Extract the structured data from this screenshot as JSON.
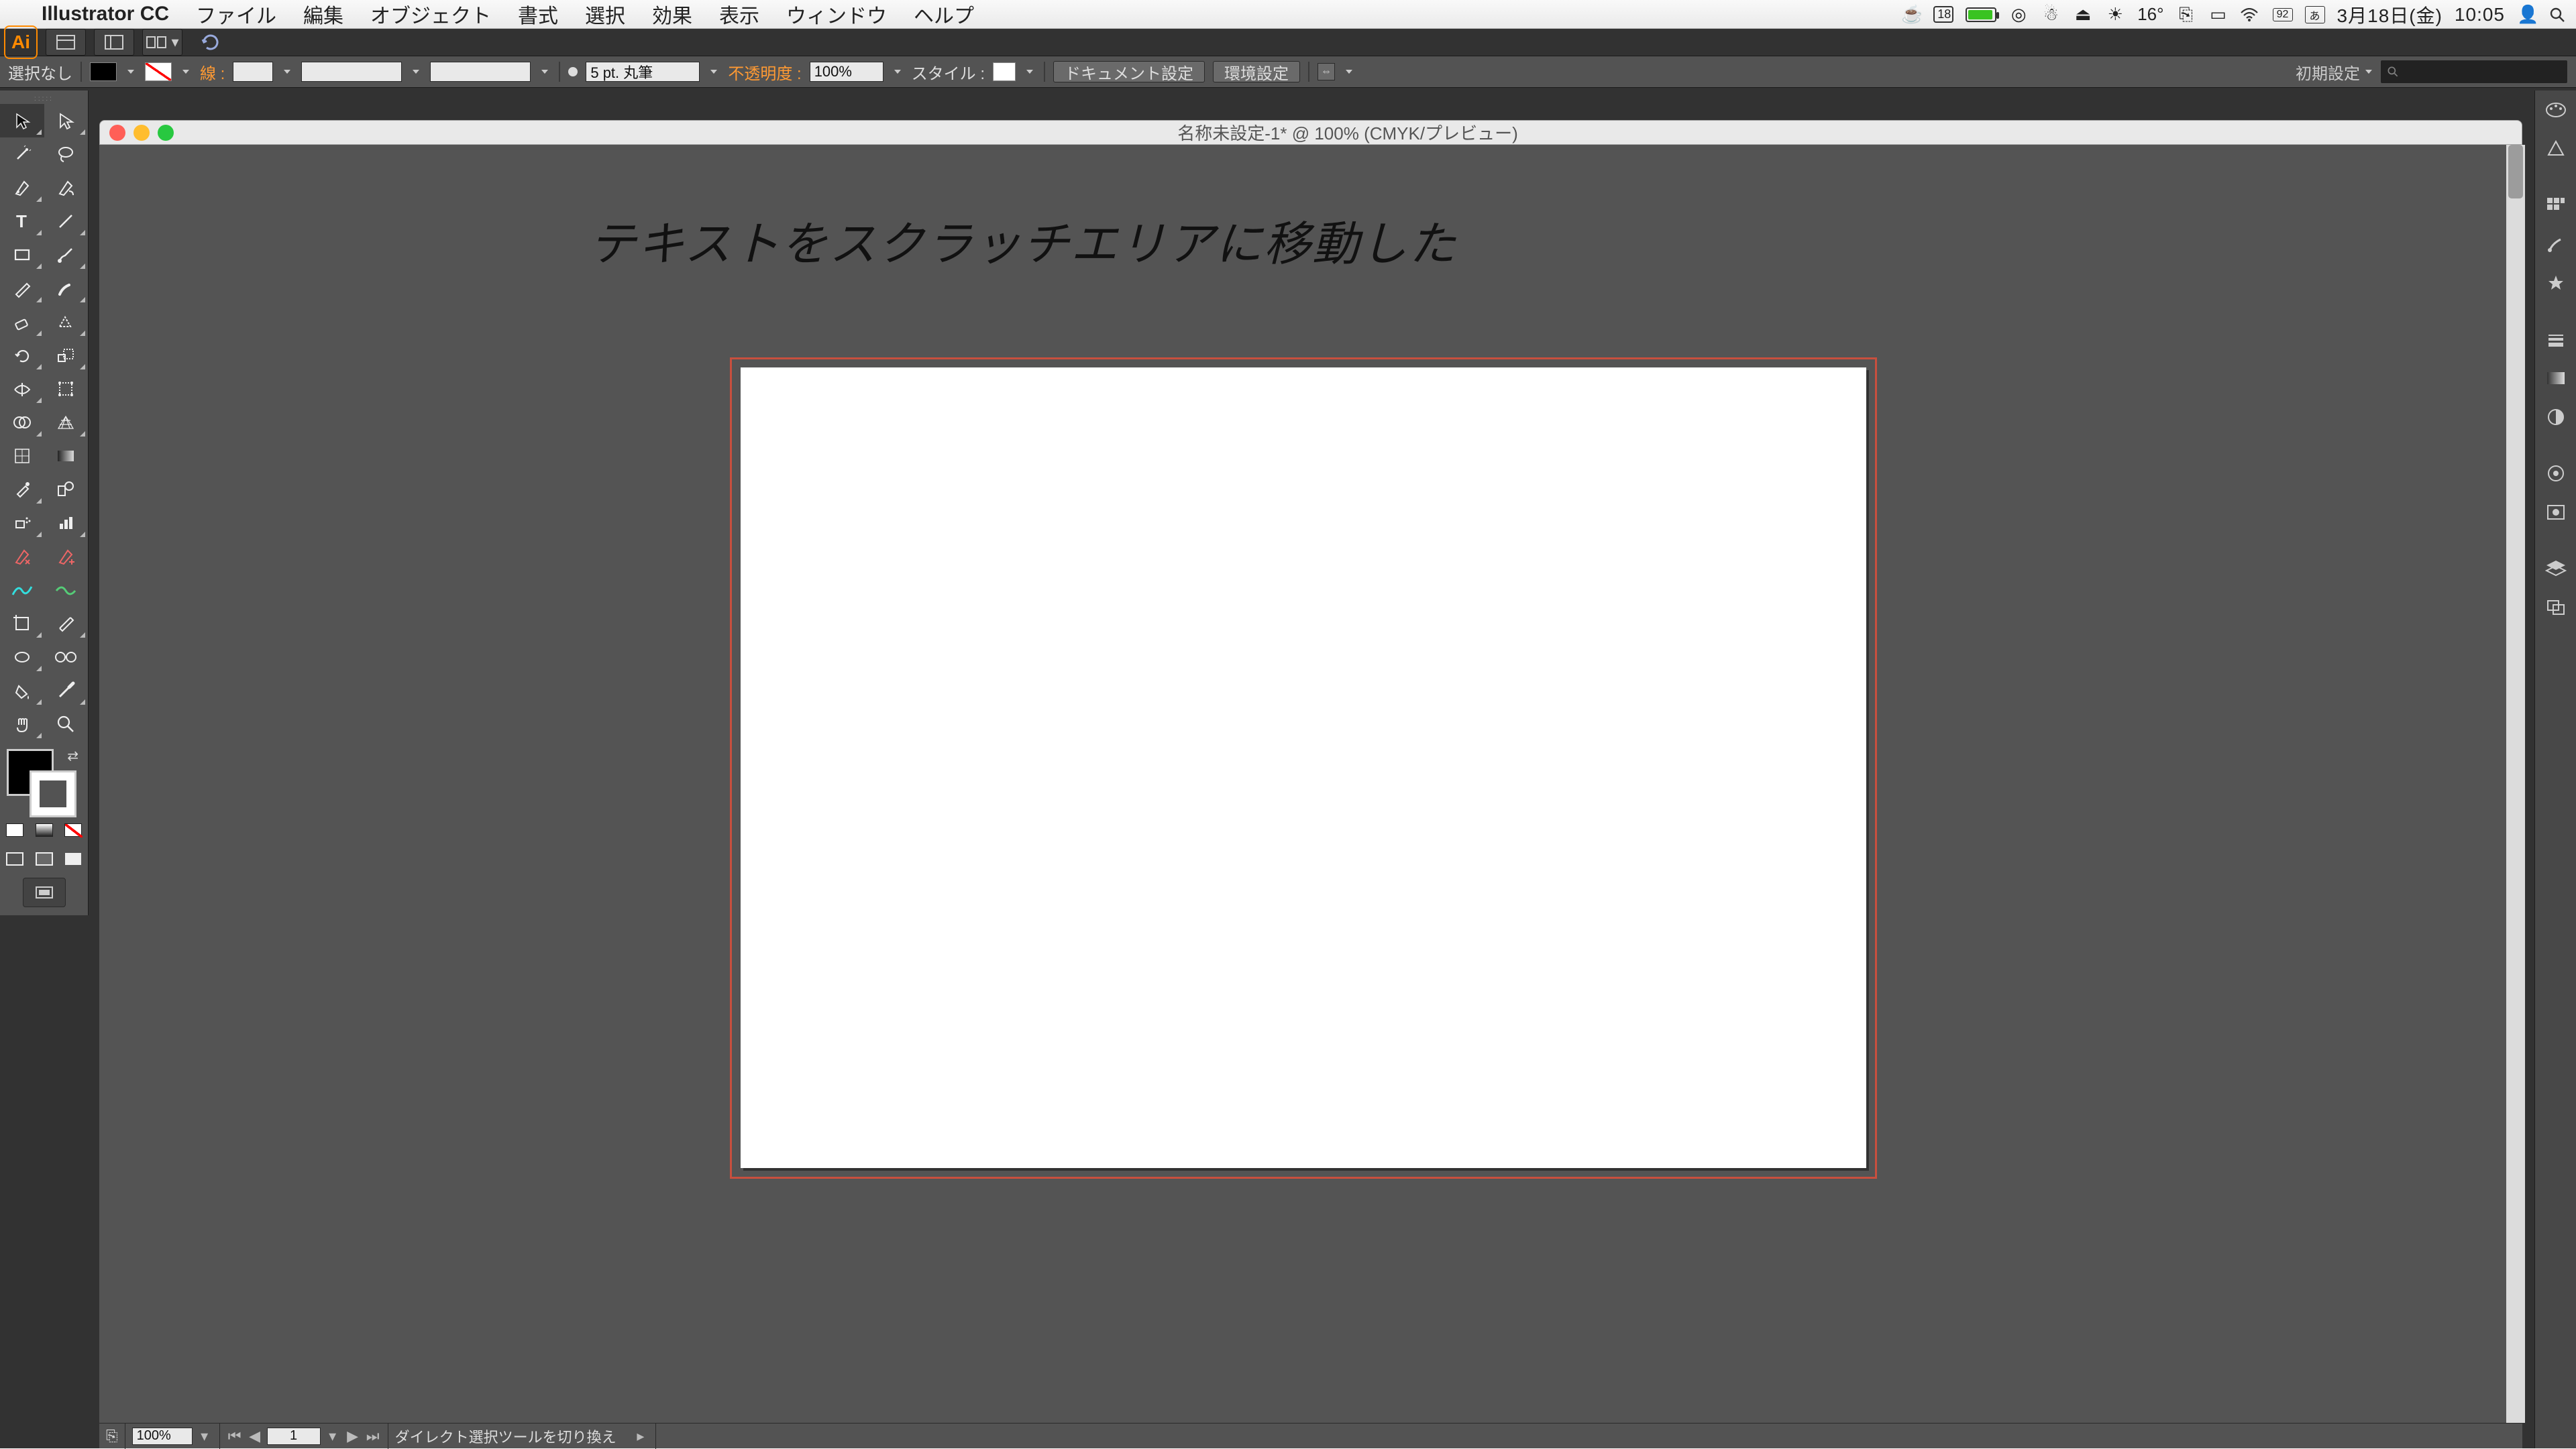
{
  "menubar": {
    "app": "Illustrator CC",
    "items": [
      "ファイル",
      "編集",
      "オブジェクト",
      "書式",
      "選択",
      "効果",
      "表示",
      "ウィンドウ",
      "ヘルプ"
    ],
    "right": {
      "temp": "16°",
      "calday": "18",
      "date": "3月18日(金)",
      "time": "10:05"
    }
  },
  "appbar": {
    "workspace": "初期設定"
  },
  "controlbar": {
    "selection": "選択なし",
    "stroke_label": "線 :",
    "stroke_weight": "5 pt. 丸筆",
    "opacity_label": "不透明度 :",
    "opacity_value": "100%",
    "style_label": "スタイル :",
    "btn_docsetup": "ドキュメント設定",
    "btn_prefs": "環境設定"
  },
  "document": {
    "title": "名称未設定-1* @ 100% (CMYK/プレビュー)",
    "scratch_text": "テキストをスクラッチエリアに移動した"
  },
  "status": {
    "zoom": "100%",
    "artboard_index": "1",
    "hint": "ダイレクト選択ツールを切り換え"
  }
}
